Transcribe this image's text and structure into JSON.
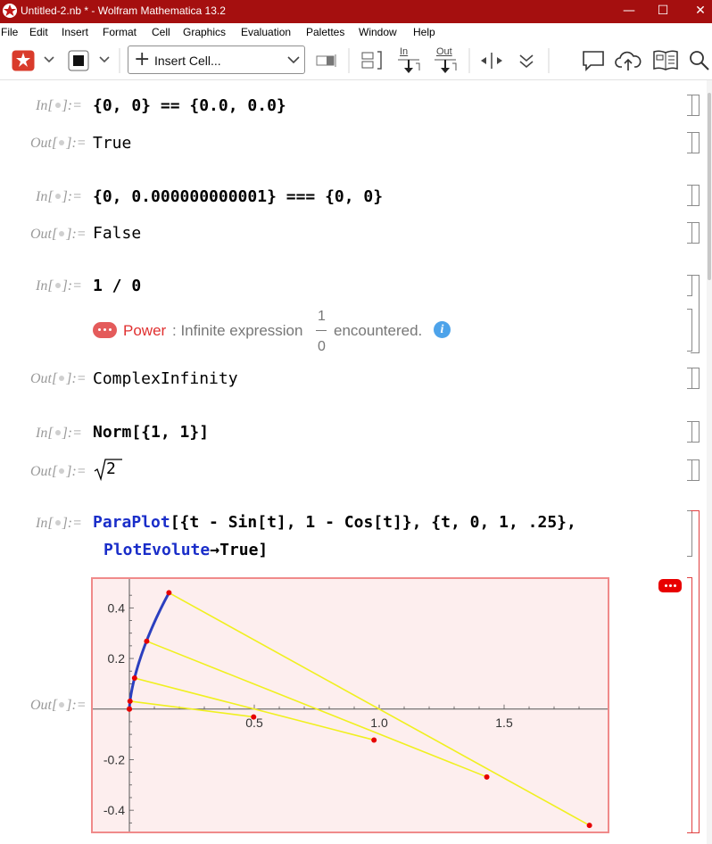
{
  "window": {
    "title": "Untitled-2.nb * - Wolfram Mathematica 13.2",
    "controls": {
      "minimize": "—",
      "maximize": "☐",
      "close": "✕"
    }
  },
  "menu": [
    {
      "label": "File"
    },
    {
      "label": "Edit"
    },
    {
      "label": "Insert"
    },
    {
      "label": "Format"
    },
    {
      "label": "Cell"
    },
    {
      "label": "Graphics"
    },
    {
      "label": "Evaluation"
    },
    {
      "label": "Palettes"
    },
    {
      "label": "Window"
    },
    {
      "label": "Help"
    }
  ],
  "toolbar": {
    "insert_cell_label": "Insert Cell...",
    "in_label": "In",
    "out_label": "Out",
    "icons": [
      "evaluate-icon",
      "stop-icon",
      "insert-cell-dropdown",
      "cell-style-icon",
      "group-icon",
      "in-icon",
      "out-icon",
      "resize-icon",
      "expand-icon",
      "chat-icon",
      "cloud-icon",
      "documentation-icon",
      "search-icon"
    ]
  },
  "labels": {
    "in": "In[",
    "out": "Out[",
    "close": "]:="
  },
  "cells": {
    "c1": {
      "input": "{0, 0} == {0.0, 0.0}",
      "output": "True"
    },
    "c2": {
      "input": "{0, 0.000000000001} === {0, 0}",
      "output": "False"
    },
    "c3": {
      "input": "1 / 0",
      "message": {
        "tag": "Power",
        "text": ": Infinite expression",
        "num": "1",
        "den": "0",
        "tail": "encountered.",
        "info_icon": "i"
      },
      "output": "ComplexInfinity"
    },
    "c4": {
      "input": "Norm[{1, 1}]",
      "output_radicand": "2"
    },
    "c5": {
      "input_head": "ParaPlot",
      "input_rest": "[{t - Sin[t], 1 - Cos[t]}, {t, 0, 1, .25},",
      "input_line2_option": "PlotEvolute",
      "input_line2_arrow": "→",
      "input_line2_value": "True]"
    }
  },
  "chart_data": {
    "type": "line",
    "xlim": [
      0,
      1.9
    ],
    "ylim": [
      -0.47,
      0.5
    ],
    "x_ticks": [
      "0.5",
      "1.0",
      "1.5"
    ],
    "x_tick_values": [
      0.5,
      1.0,
      1.5
    ],
    "y_ticks": [
      "0.4",
      "0.2",
      "-0.2",
      "-0.4"
    ],
    "y_tick_values": [
      0.4,
      0.2,
      -0.2,
      -0.4
    ],
    "curve": [
      {
        "x": 0.0,
        "y": 0.0
      },
      {
        "x": 0.0026,
        "y": 0.0311
      },
      {
        "x": 0.0208,
        "y": 0.1224
      },
      {
        "x": 0.0694,
        "y": 0.2683
      },
      {
        "x": 0.1585,
        "y": 0.4597
      }
    ],
    "evolute_points": [
      {
        "x": 0.0,
        "y": 0.0
      },
      {
        "x": 0.4974,
        "y": -0.0311
      },
      {
        "x": 0.9792,
        "y": -0.1224
      },
      {
        "x": 1.4306,
        "y": -0.2683
      },
      {
        "x": 1.8415,
        "y": -0.4597
      }
    ],
    "curve_color": "#2b3fbf",
    "segment_color": "#f0f020",
    "point_color": "#e60000",
    "background": "#fdeeee",
    "frame_color": "#f08a8a"
  }
}
